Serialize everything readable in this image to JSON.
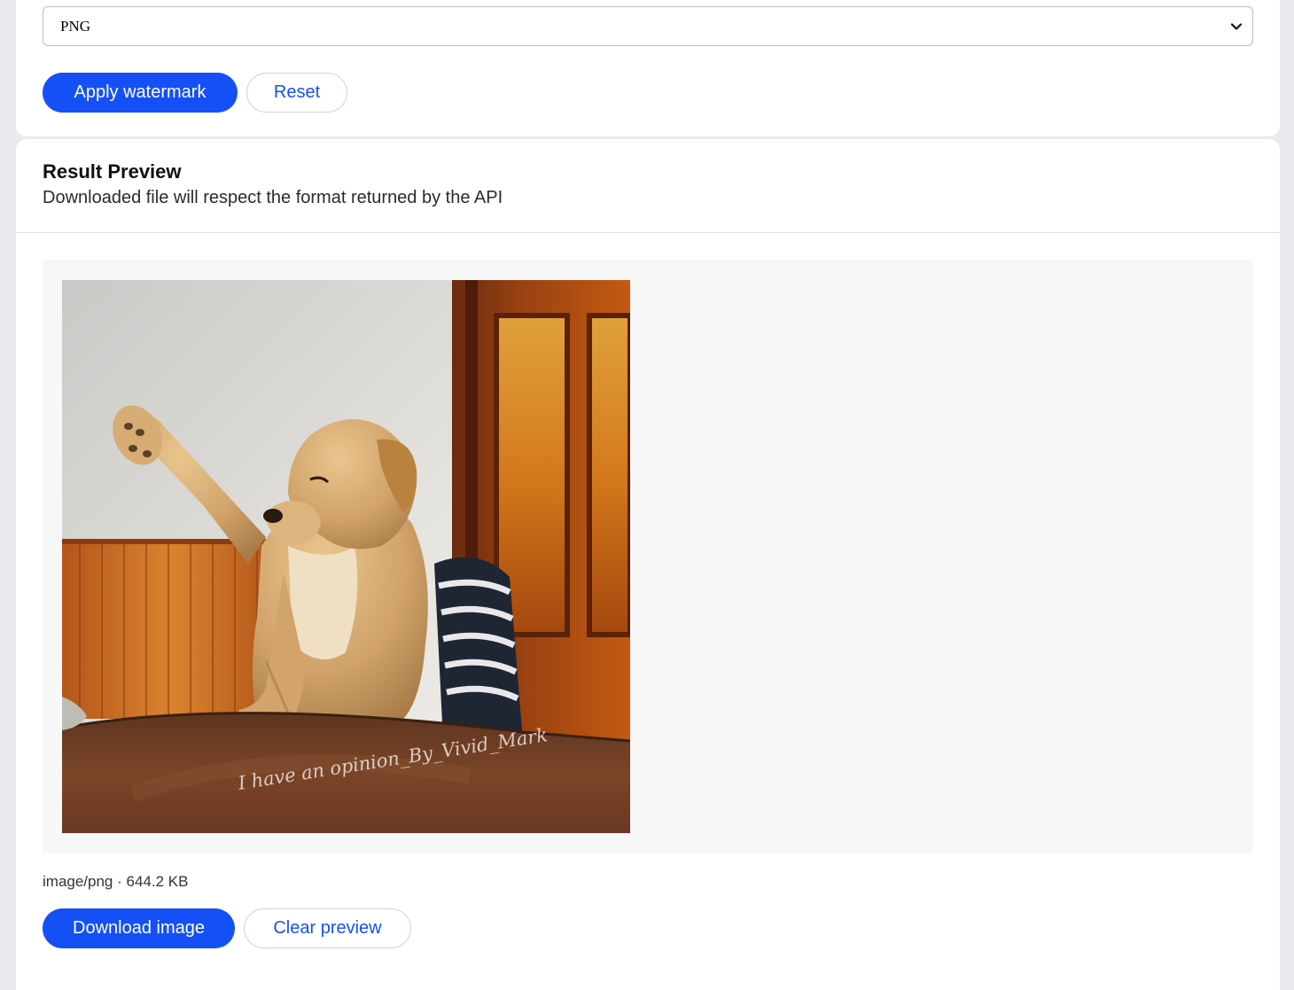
{
  "settings": {
    "format_select": {
      "selected": "PNG"
    },
    "apply_label": "Apply watermark",
    "reset_label": "Reset"
  },
  "result": {
    "title": "Result Preview",
    "subtitle": "Downloaded file will respect the format returned by the API",
    "image": {
      "watermark_text": "I have an opinion_By_Vivid_Mark"
    },
    "file_meta": "image/png · 644.2 KB",
    "download_label": "Download image",
    "clear_label": "Clear preview"
  },
  "colors": {
    "accent": "#1450f5",
    "page_background": "#e8eaee",
    "card": "#ffffff",
    "preview_background": "#f7f7f8"
  }
}
